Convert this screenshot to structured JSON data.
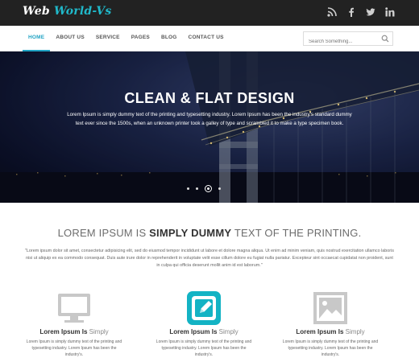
{
  "brand": {
    "part1": "Web",
    "part2": "World-Vs"
  },
  "social": [
    "rss-icon",
    "facebook-icon",
    "twitter-icon",
    "linkedin-icon"
  ],
  "nav": {
    "items": [
      {
        "label": "HOME",
        "active": true
      },
      {
        "label": "ABOUT US",
        "active": false
      },
      {
        "label": "SERVICE",
        "active": false
      },
      {
        "label": "PAGES",
        "active": false
      },
      {
        "label": "BLOG",
        "active": false
      },
      {
        "label": "CONTACT US",
        "active": false
      }
    ]
  },
  "search": {
    "placeholder": "Search Something...",
    "value": ""
  },
  "hero": {
    "title": "CLEAN & FLAT DESIGN",
    "text": "Lorem Ipsum is simply dummy text of the printing and typesetting industry. Lorem Ipsum has been the industry's standard dummy text ever since the 1500s, when an unknown printer took a galley of type and scrambled it to make a type specimen book.",
    "slides": 4,
    "active_slide": 3
  },
  "intro": {
    "title_pre": "LOREM IPSUM IS",
    "title_bold": "SIMPLY DUMMY",
    "title_post": "TEXT OF THE PRINTING.",
    "text": "\"Lorem ipsum dolor sit amet, consectetur adipisicing elit, sed do eiusmod tempor incididunt ut labore et dolore magna aliqua. Ut enim ad minim veniam, quis nostrud exercitation ullamco laboris nisi ut aliquip ex ea commodo consequat. Duis aute irure dolor in reprehenderit in voluptate velit esse cillum dolore eu fugiat nulla pariatur. Excepteur sint occaecat cupidatat non proident, sunt in culpa qui officia deserunt mollit anim id est laborum.\""
  },
  "features": [
    {
      "icon": "monitor-icon",
      "title_bold": "Lorem Ipsum Is",
      "title_light": "Simply",
      "text": "Lorem Ipsum is simply dummy text of the printing and typesetting industry. Lorem Ipsum has been the industry's."
    },
    {
      "icon": "edit-icon",
      "title_bold": "Lorem Ipsum Is",
      "title_light": "Simply",
      "text": "Lorem Ipsum is simply dummy text of the printing and typesetting industry. Lorem Ipsum has been the industry's."
    },
    {
      "icon": "image-icon",
      "title_bold": "Lorem Ipsum Is",
      "title_light": "Simply",
      "text": "Lorem Ipsum is simply dummy text of the printing and typesetting industry. Lorem Ipsum has been the industry's."
    }
  ],
  "colors": {
    "accent": "#20b8c9",
    "topbar": "#222222",
    "feature_icon_gray": "#c8c8c8",
    "feature_icon_teal": "#13b3c4"
  }
}
